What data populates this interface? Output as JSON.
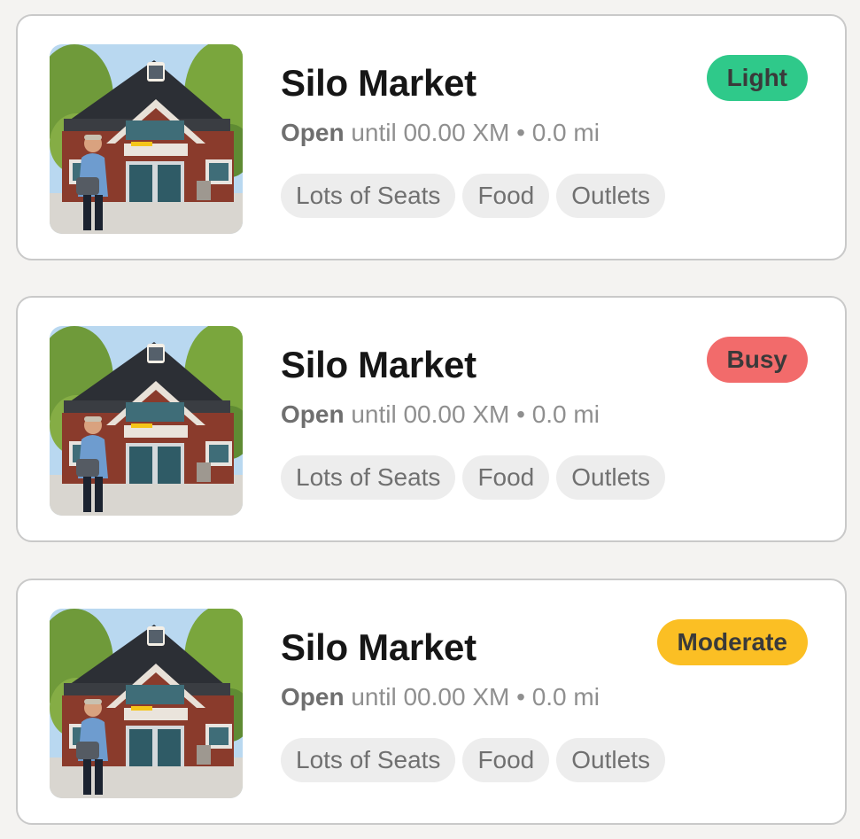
{
  "cards": [
    {
      "title": "Silo Market",
      "status_open": "Open",
      "status_rest": "until 00.00 XM • 0.0 mi",
      "badge": "Light",
      "badge_color": "#2fc98a",
      "tags": [
        "Lots of Seats",
        "Food",
        "Outlets"
      ],
      "image": "storefront-photo"
    },
    {
      "title": "Silo Market",
      "status_open": "Open",
      "status_rest": "until 00.00 XM • 0.0 mi",
      "badge": "Busy",
      "badge_color": "#f26b6b",
      "tags": [
        "Lots of Seats",
        "Food",
        "Outlets"
      ],
      "image": "storefront-photo"
    },
    {
      "title": "Silo Market",
      "status_open": "Open",
      "status_rest": "until 00.00 XM • 0.0 mi",
      "badge": "Moderate",
      "badge_color": "#fbbf24",
      "tags": [
        "Lots of Seats",
        "Food",
        "Outlets"
      ],
      "image": "storefront-photo"
    }
  ]
}
